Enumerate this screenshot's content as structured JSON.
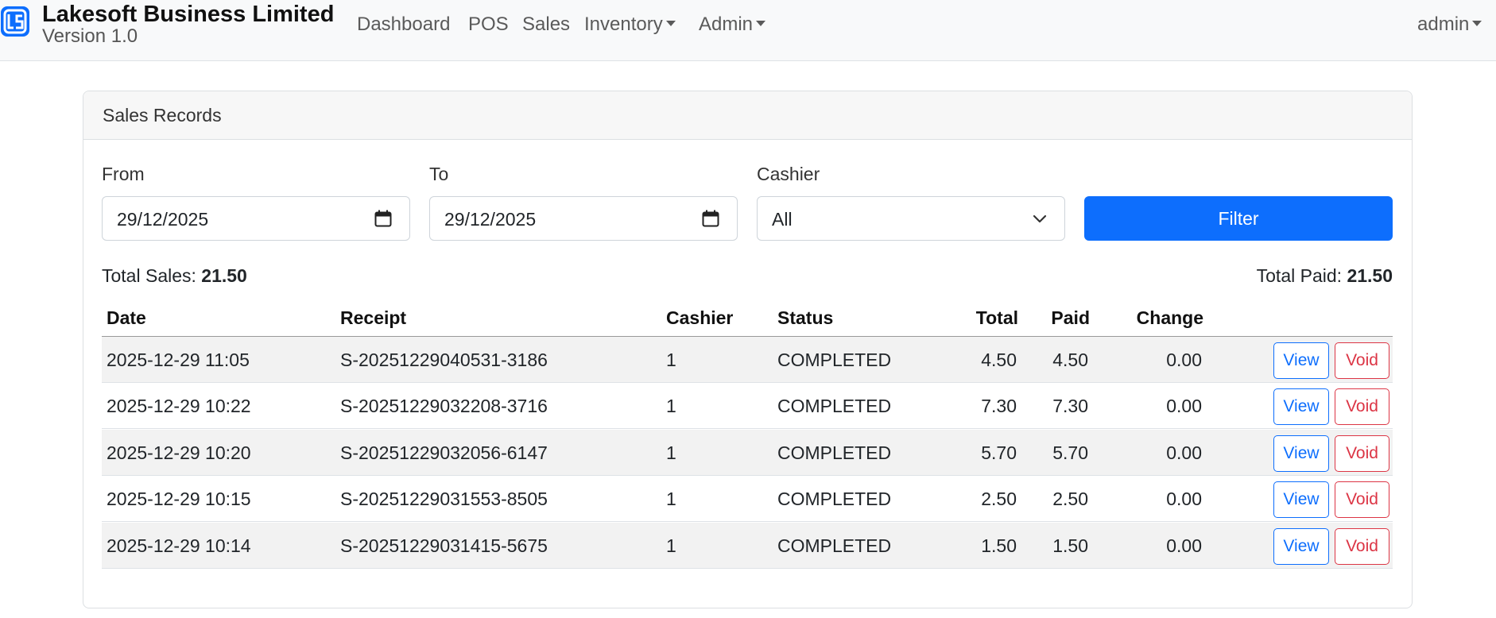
{
  "brand": {
    "title": "Lakesoft Business Limited",
    "version": "Version 1.0",
    "logo_icon": "ls-logo-icon",
    "logo_color": "#0d6efd"
  },
  "nav": {
    "dashboard": "Dashboard",
    "pos": "POS",
    "sales": "Sales",
    "inventory": "Inventory",
    "admin": "Admin",
    "user": "admin"
  },
  "card": {
    "title": "Sales Records"
  },
  "filters": {
    "from_label": "From",
    "from_value": "29/12/2025",
    "to_label": "To",
    "to_value": "29/12/2025",
    "cashier_label": "Cashier",
    "cashier_value": "All",
    "filter_button": "Filter"
  },
  "summary": {
    "total_sales_label": "Total Sales:",
    "total_sales_value": "21.50",
    "total_paid_label": "Total Paid:",
    "total_paid_value": "21.50"
  },
  "table": {
    "headers": {
      "date": "Date",
      "receipt": "Receipt",
      "cashier": "Cashier",
      "status": "Status",
      "total": "Total",
      "paid": "Paid",
      "change": "Change"
    },
    "view_label": "View",
    "void_label": "Void",
    "rows": [
      {
        "date": "2025-12-29 11:05",
        "receipt": "S-20251229040531-3186",
        "cashier": "1",
        "status": "COMPLETED",
        "total": "4.50",
        "paid": "4.50",
        "change": "0.00"
      },
      {
        "date": "2025-12-29 10:22",
        "receipt": "S-20251229032208-3716",
        "cashier": "1",
        "status": "COMPLETED",
        "total": "7.30",
        "paid": "7.30",
        "change": "0.00"
      },
      {
        "date": "2025-12-29 10:20",
        "receipt": "S-20251229032056-6147",
        "cashier": "1",
        "status": "COMPLETED",
        "total": "5.70",
        "paid": "5.70",
        "change": "0.00"
      },
      {
        "date": "2025-12-29 10:15",
        "receipt": "S-20251229031553-8505",
        "cashier": "1",
        "status": "COMPLETED",
        "total": "2.50",
        "paid": "2.50",
        "change": "0.00"
      },
      {
        "date": "2025-12-29 10:14",
        "receipt": "S-20251229031415-5675",
        "cashier": "1",
        "status": "COMPLETED",
        "total": "1.50",
        "paid": "1.50",
        "change": "0.00"
      }
    ]
  }
}
